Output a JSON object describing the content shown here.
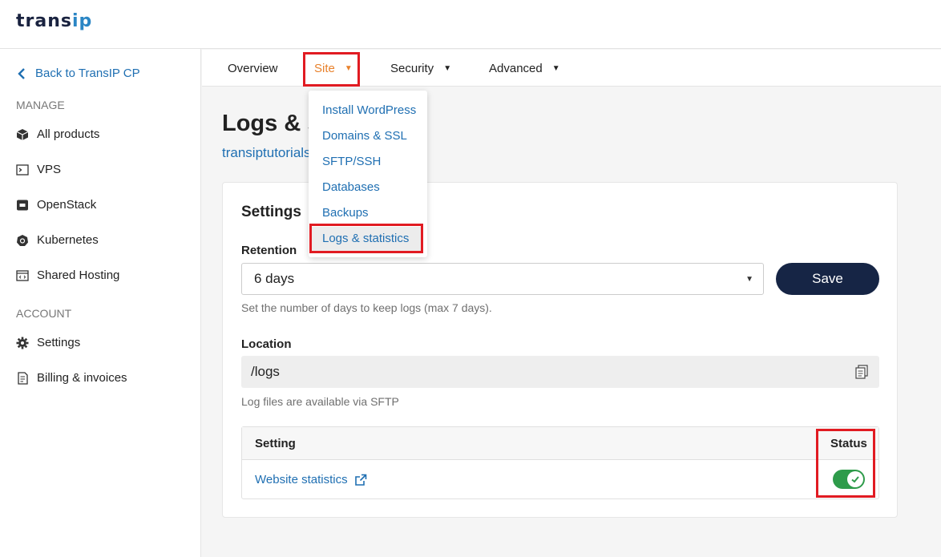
{
  "brand": {
    "logo_main": "trans",
    "logo_accent": "ip"
  },
  "sidebar": {
    "back_label": "Back to TransIP CP",
    "manage_label": "MANAGE",
    "account_label": "ACCOUNT",
    "items": [
      {
        "label": "All products",
        "icon": "cube-icon"
      },
      {
        "label": "VPS",
        "icon": "terminal-icon"
      },
      {
        "label": "OpenStack",
        "icon": "openstack-icon"
      },
      {
        "label": "Kubernetes",
        "icon": "kubernetes-icon"
      },
      {
        "label": "Shared Hosting",
        "icon": "code-window-icon"
      }
    ],
    "account_items": [
      {
        "label": "Settings",
        "icon": "gear-icon"
      },
      {
        "label": "Billing & invoices",
        "icon": "invoice-icon"
      }
    ]
  },
  "nav": {
    "tabs": [
      {
        "label": "Overview"
      },
      {
        "label": "Site"
      },
      {
        "label": "Security"
      },
      {
        "label": "Advanced"
      }
    ],
    "site_menu": [
      "Install WordPress",
      "Domains & SSL",
      "SFTP/SSH",
      "Databases",
      "Backups",
      "Logs & statistics"
    ]
  },
  "page": {
    "title": "Logs & s",
    "subtitle": "transiptutorials"
  },
  "settings": {
    "title": "Settings",
    "retention_label": "Retention",
    "retention_value": "6 days",
    "save_label": "Save",
    "retention_hint": "Set the number of days to keep logs (max 7 days).",
    "location_label": "Location",
    "location_value": "/logs",
    "location_hint": "Log files are available via SFTP",
    "table": {
      "col_setting": "Setting",
      "col_status": "Status",
      "rows": [
        {
          "setting": "Website statistics",
          "enabled": true
        }
      ]
    }
  },
  "colors": {
    "accent": "#1f6fb2",
    "active_tab": "#e8812b",
    "highlight": "#e11b22",
    "toggle_on": "#2e9b4a",
    "button": "#162545"
  }
}
